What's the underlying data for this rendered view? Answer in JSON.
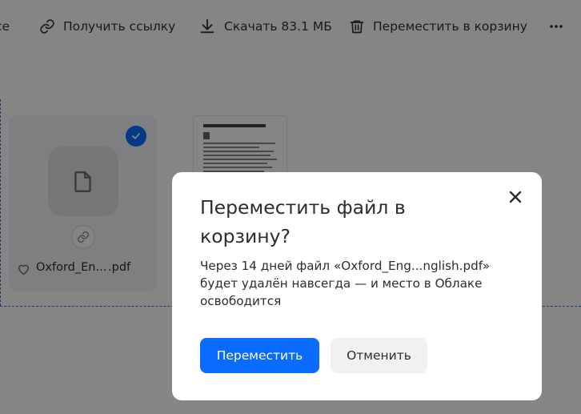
{
  "toolbar": {
    "cut_label": "се",
    "link_label": "Получить ссылку",
    "download_label": "Скачать 83.1 МБ",
    "trash_label": "Переместить в корзину",
    "more_icon": "more-horizontal-icon"
  },
  "file_card": {
    "name_start": "Oxford_En...",
    "name_end": ".pdf",
    "selected": true,
    "icons": [
      "file-icon",
      "check-icon",
      "link-icon",
      "heart-icon"
    ]
  },
  "dialog": {
    "title": "Переместить файл в корзину?",
    "text": "Через 14 дней файл «Oxford_Eng...nglish.pdf» будет удалён навсегда — и место в Облаке освободится",
    "confirm_label": "Переместить",
    "cancel_label": "Отменить",
    "close_icon": "close-icon"
  },
  "colors": {
    "accent": "#0a6cff",
    "text": "#2c2d2e",
    "overlay": "rgba(0,0,0,0.48)"
  }
}
